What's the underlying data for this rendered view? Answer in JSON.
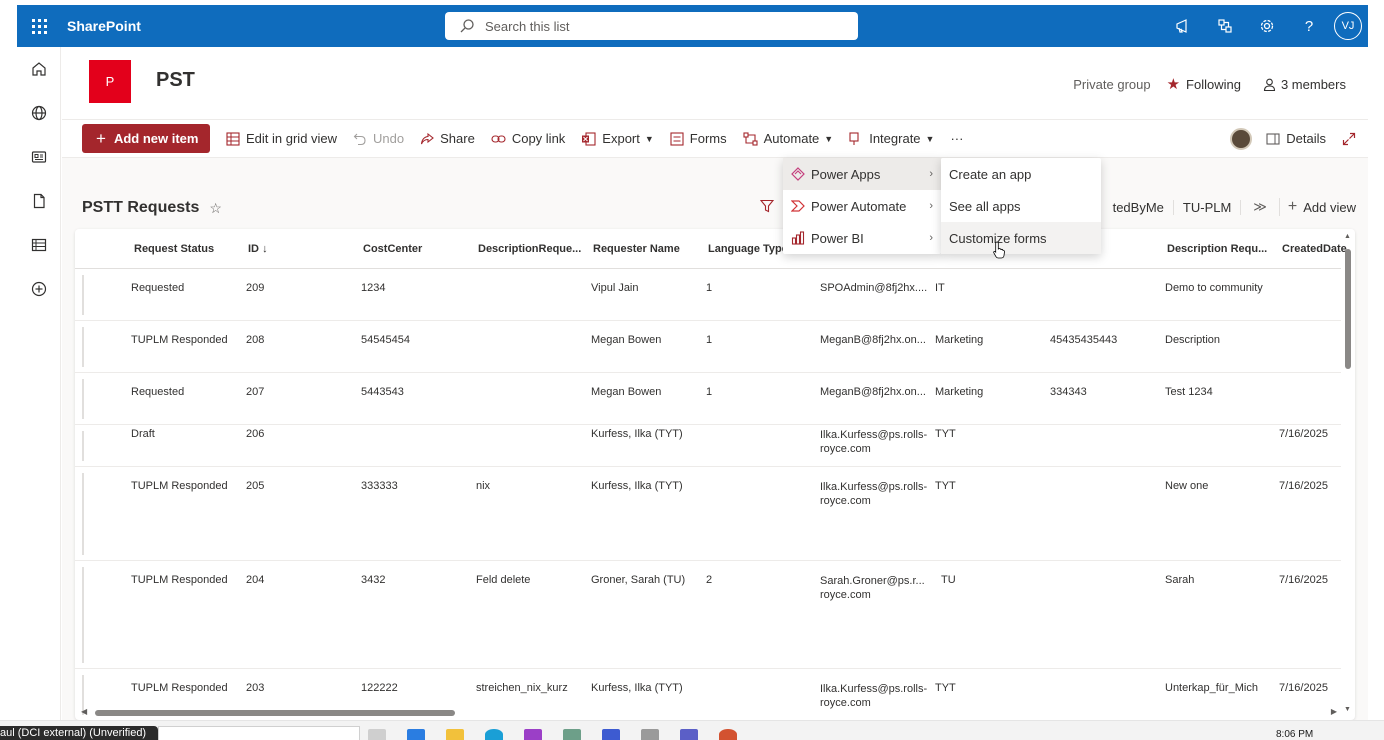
{
  "suite_bar": {
    "app_name": "SharePoint",
    "search_placeholder": "Search this list",
    "user_initials": "VJ",
    "icons": [
      "waffle-icon",
      "megaphone-icon",
      "share-network-icon",
      "gear-icon",
      "help-icon"
    ]
  },
  "left_rail": {
    "icons": [
      "home-icon",
      "globe-icon",
      "news-icon",
      "document-icon",
      "list-icon",
      "add-circle-icon"
    ]
  },
  "site": {
    "logo_letter": "P",
    "title": "PST",
    "private_group": "Private group",
    "following": "Following",
    "members": "3 members"
  },
  "command_bar": {
    "add_new_item": "Add new item",
    "edit_grid": "Edit in grid view",
    "undo": "Undo",
    "share": "Share",
    "copy_link": "Copy link",
    "export": "Export",
    "forms": "Forms",
    "automate": "Automate",
    "integrate": "Integrate",
    "more": "···",
    "details": "Details"
  },
  "list": {
    "title": "PSTT Requests",
    "views": [
      "tedByMe",
      "TU-PLM"
    ],
    "more_views": "≫",
    "add_view": "Add view"
  },
  "integrate_menu": {
    "items": [
      {
        "label": "Power Apps",
        "icon": "power-apps-icon",
        "color": "#c43e7c"
      },
      {
        "label": "Power Automate",
        "icon": "power-automate-icon",
        "color": "#d13438"
      },
      {
        "label": "Power BI",
        "icon": "power-bi-icon",
        "color": "#a4262c"
      }
    ]
  },
  "power_apps_submenu": {
    "items": [
      "Create an app",
      "See all apps",
      "Customize forms"
    ]
  },
  "table": {
    "columns": [
      "Request Status",
      "ID",
      "CostCenter",
      "DescriptionReque...",
      "Requester Name",
      "Language Type",
      "",
      "",
      "",
      "Description Requ...",
      "CreatedDate"
    ],
    "rows": [
      {
        "status": "Requested",
        "id": "209",
        "cost": "1234",
        "desc": "",
        "requester": "Vipul Jain",
        "lang": "1",
        "email": "SPOAdmin@8fj2hx....",
        "dept": "IT",
        "num": "",
        "description": "Demo to community",
        "date": ""
      },
      {
        "status": "TUPLM Responded",
        "id": "208",
        "cost": "54545454",
        "desc": "",
        "requester": "Megan Bowen",
        "lang": "1",
        "email": "MeganB@8fj2hx.on...",
        "dept": "Marketing",
        "num": "45435435443",
        "description": "Description",
        "date": ""
      },
      {
        "status": "Requested",
        "id": "207",
        "cost": "5443543",
        "desc": "",
        "requester": "Megan Bowen",
        "lang": "1",
        "email": "MeganB@8fj2hx.on...",
        "dept": "Marketing",
        "num": "334343",
        "description": "Test 1234",
        "date": ""
      },
      {
        "status": "Draft",
        "id": "206",
        "cost": "",
        "desc": "",
        "requester": "Kurfess, Ilka (TYT)",
        "lang": "",
        "email": "Ilka.Kurfess@ps.rolls-royce.com",
        "dept": "TYT",
        "num": "",
        "description": "",
        "date": "7/16/2025"
      },
      {
        "status": "TUPLM Responded",
        "id": "205",
        "cost": "333333",
        "desc": "nix",
        "requester": "Kurfess, Ilka (TYT)",
        "lang": "",
        "email": "Ilka.Kurfess@ps.rolls-royce.com",
        "dept": "TYT",
        "num": "",
        "description": "New one",
        "date": "7/16/2025"
      },
      {
        "status": "TUPLM Responded",
        "id": "204",
        "cost": "3432",
        "desc": "Feld delete",
        "requester": "Groner, Sarah (TU)",
        "lang": "2",
        "email": "Sarah.Groner@ps.r... royce.com",
        "dept": "TU",
        "num": "",
        "description": "Sarah",
        "date": "7/16/2025"
      },
      {
        "status": "TUPLM Responded",
        "id": "203",
        "cost": "122222",
        "desc": "streichen_nix_kurz",
        "requester": "Kurfess, Ilka (TYT)",
        "lang": "",
        "email": "Ilka.Kurfess@ps.rolls-royce.com",
        "dept": "TYT",
        "num": "",
        "description": "Unterkap_für_Mich",
        "date": "7/16/2025"
      }
    ]
  },
  "taskbar": {
    "tooltip": "aul (DCI external) (Unverified)",
    "clock": "8:06 PM"
  },
  "colors": {
    "suite_bar": "#0f6cbd",
    "accent": "#a4262c",
    "logo": "#e3001b"
  }
}
